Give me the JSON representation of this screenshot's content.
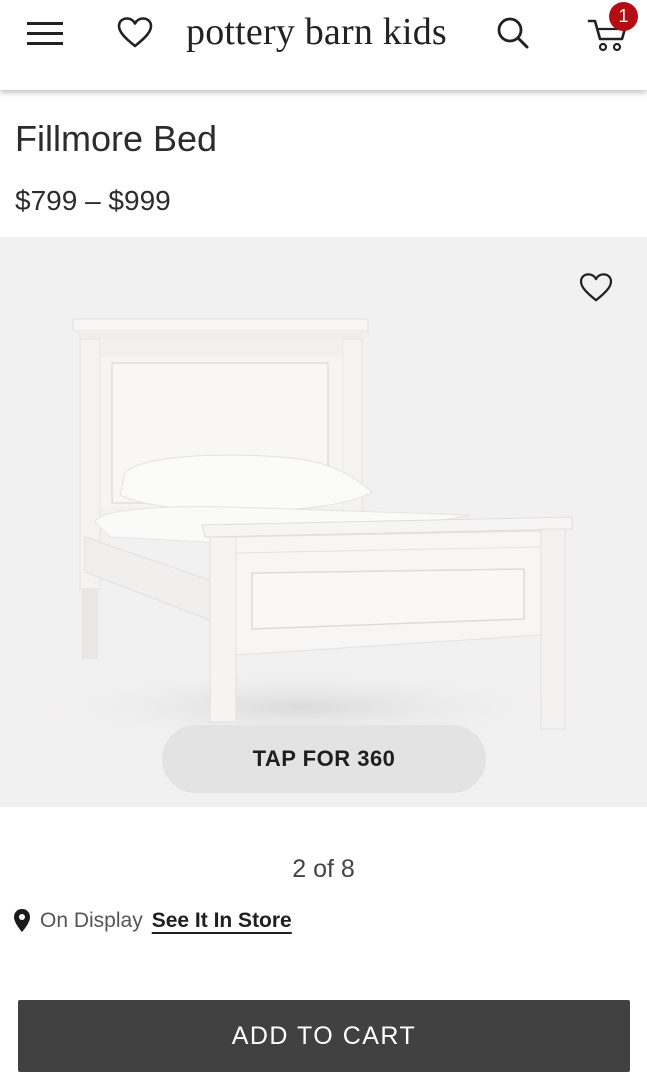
{
  "header": {
    "logo": "pottery barn kids",
    "menu_icon": "hamburger-menu-icon",
    "wishlist_icon": "heart-outline-icon",
    "search_icon": "search-icon",
    "cart_icon": "shopping-cart-icon",
    "cart_count": "1",
    "badge_color": "#b50d14"
  },
  "product": {
    "name": "Fillmore Bed",
    "price_range": "$799 – $999",
    "gallery": {
      "image_icon": "bed-product-image",
      "favorite_icon": "heart-outline-icon",
      "tap_360_label": "TAP FOR 360",
      "counter": "2 of 8"
    },
    "availability": {
      "pin_icon": "location-pin-icon",
      "status_text": "On Display",
      "link_text": "See It In Store"
    },
    "add_to_cart_label": "ADD TO CART",
    "button_color": "#414141"
  }
}
